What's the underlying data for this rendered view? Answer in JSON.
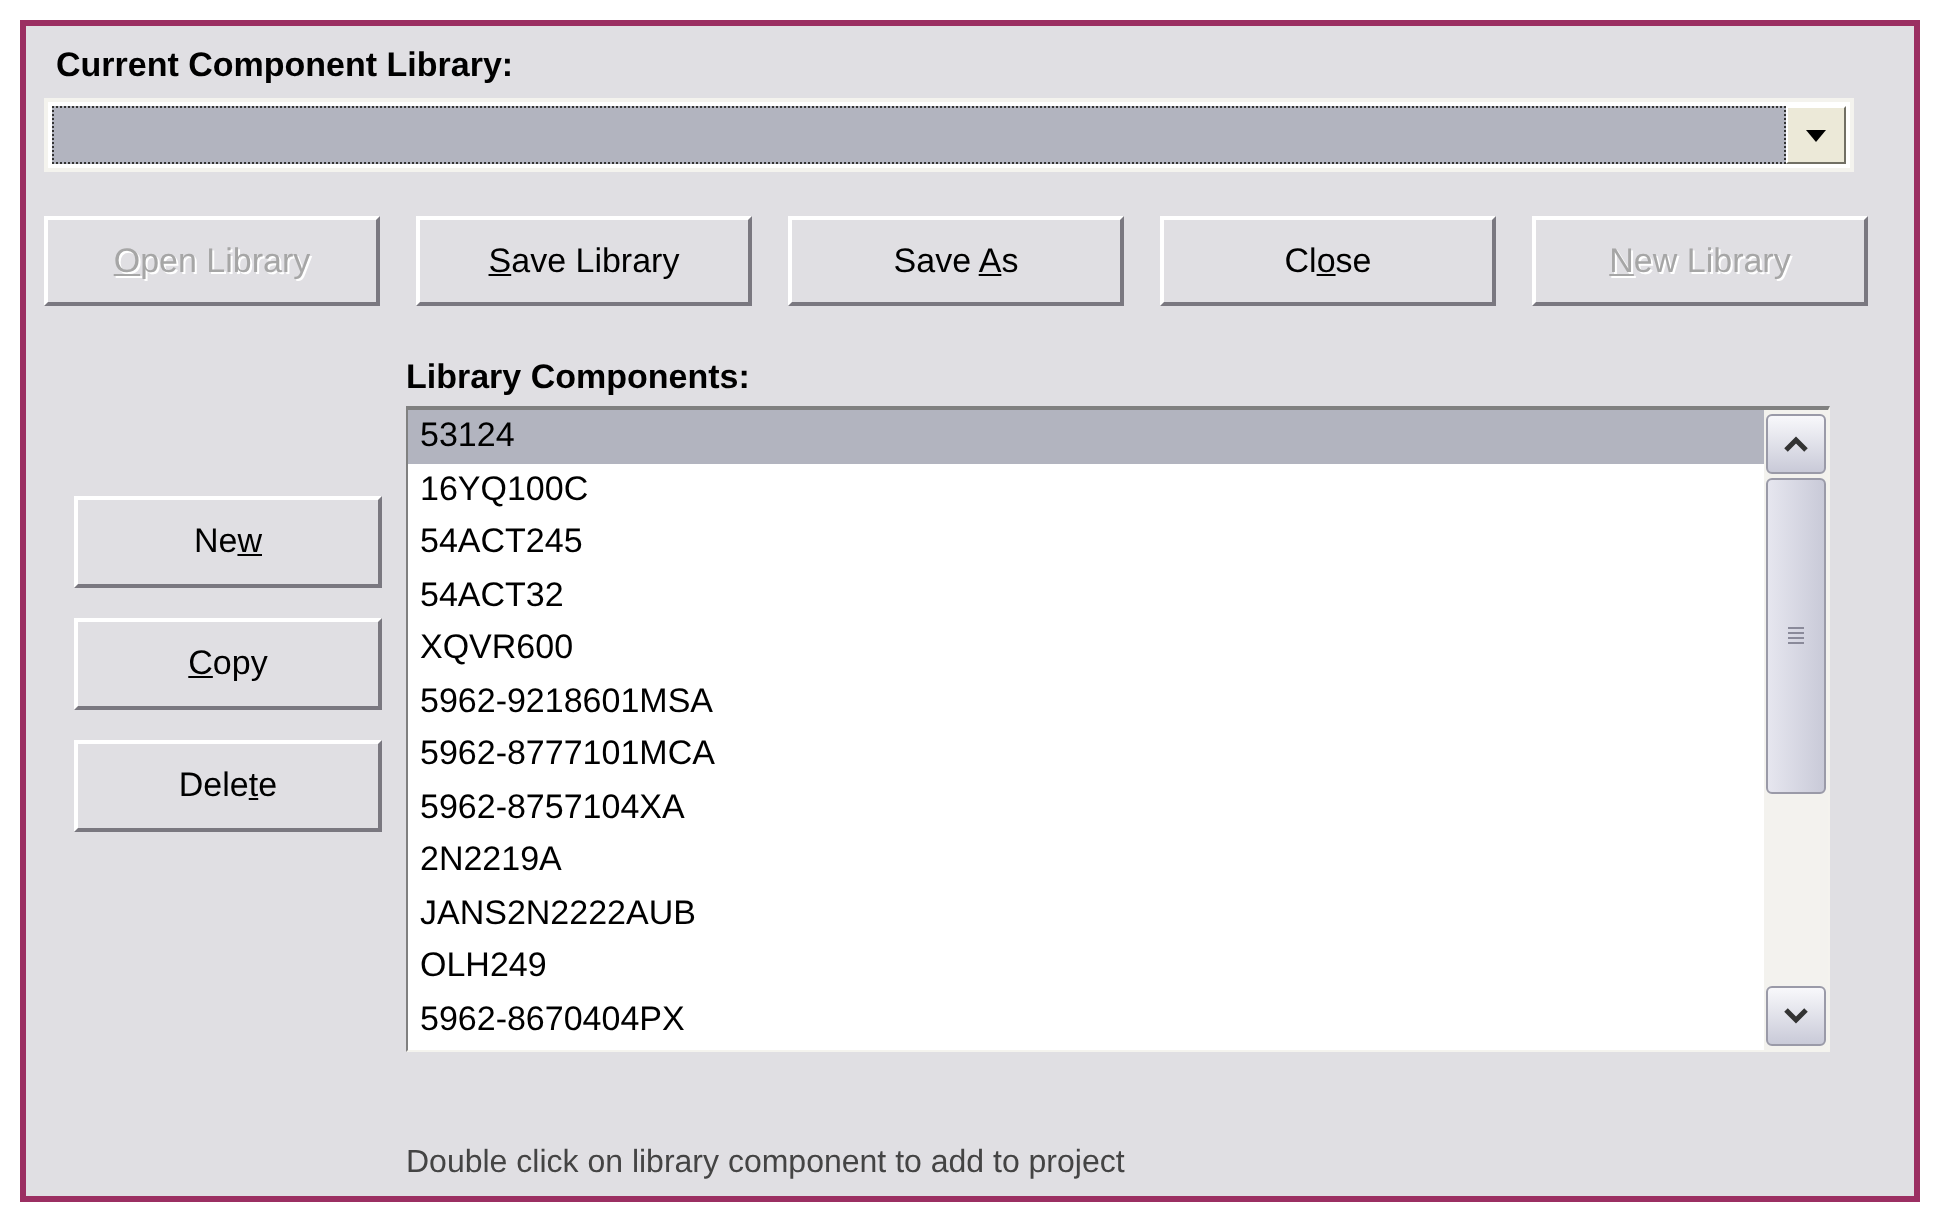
{
  "current_library": {
    "label": "Current Component Library:",
    "value_selected": true
  },
  "library_buttons": [
    {
      "key": "O",
      "post": "pen Library",
      "disabled": true
    },
    {
      "key": "S",
      "post": "ave Library",
      "disabled": false
    },
    {
      "pre": "Save ",
      "key": "A",
      "post": "s",
      "disabled": false
    },
    {
      "pre": "Cl",
      "key": "o",
      "post": "se",
      "disabled": false
    },
    {
      "key": "N",
      "post": "ew Library",
      "disabled": true
    }
  ],
  "component_buttons": [
    {
      "pre": "Ne",
      "key": "w"
    },
    {
      "key": "C",
      "post": "opy"
    },
    {
      "pre": "Dele",
      "key": "t",
      "post": "e"
    }
  ],
  "components": {
    "label": "Library Components:",
    "items": [
      {
        "text": "53124",
        "selected": true
      },
      {
        "text": "16YQ100C",
        "selected": false
      },
      {
        "text": "54ACT245",
        "selected": false
      },
      {
        "text": "54ACT32",
        "selected": false
      },
      {
        "text": "XQVR600",
        "selected": false
      },
      {
        "text": "5962-9218601MSA",
        "selected": false
      },
      {
        "text": "5962-8777101MCA",
        "selected": false
      },
      {
        "text": "5962-8757104XA",
        "selected": false
      },
      {
        "text": "2N2219A",
        "selected": false
      },
      {
        "text": "JANS2N2222AUB",
        "selected": false
      },
      {
        "text": "OLH249",
        "selected": false
      },
      {
        "text": "5962-8670404PX",
        "selected": false
      }
    ]
  },
  "hint": "Double click on library component to add to project"
}
